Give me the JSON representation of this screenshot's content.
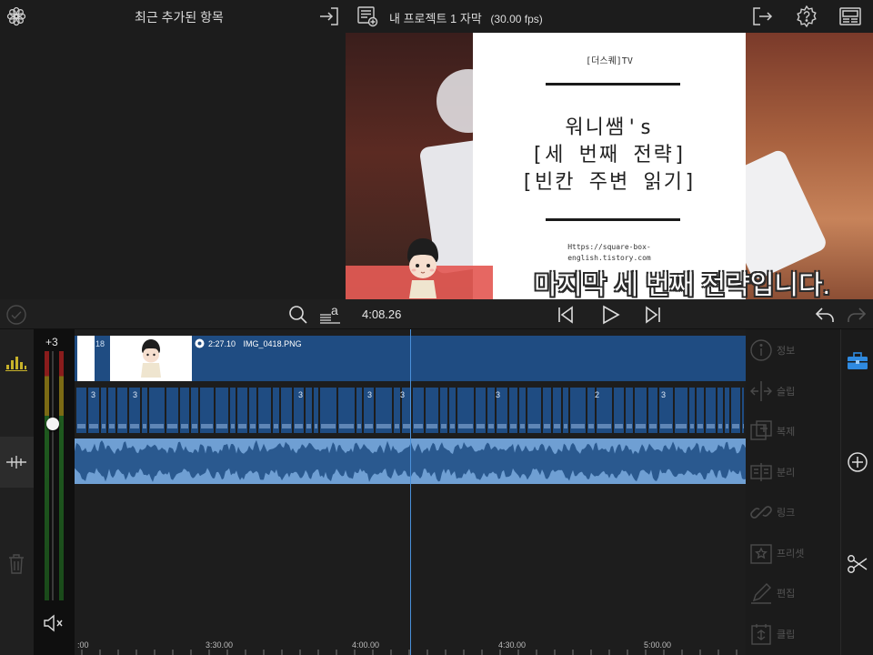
{
  "media_browser": {
    "title": "최근 추가된 항목"
  },
  "project": {
    "title": "내 프로젝트 1 자막",
    "fps": "(30.00 fps)"
  },
  "preview": {
    "card_brand": "[더스퀘]TV",
    "card_title_1": "워니쌤's",
    "card_title_2": "[세 번째 전략]",
    "card_title_3": "[빈칸 주변 읽기]",
    "card_url_1": "Https://square-box-",
    "card_url_2": "english.tistory.com",
    "subtitle": "마지막 세 번째 전략입니다."
  },
  "transport": {
    "timecode": "4:08.26"
  },
  "meter": {
    "level_label": "+3",
    "volume_level": 0.85
  },
  "timeline": {
    "clip_duration": "2:27.10",
    "clip_name": "IMG_0418.PNG",
    "clip_number_fragment": "18",
    "title_markers": [
      "3",
      "3",
      "3",
      "3",
      "3",
      "2",
      "3",
      "3"
    ],
    "ruler_labels": [
      ":00",
      "3:30.00",
      "4:00.00",
      "4:30.00",
      "5:00.00"
    ]
  },
  "tools": {
    "items": [
      {
        "label": "정보",
        "icon": "info-icon"
      },
      {
        "label": "슬립",
        "icon": "slip-icon"
      },
      {
        "label": "복제",
        "icon": "duplicate-icon"
      },
      {
        "label": "분리",
        "icon": "split-icon"
      },
      {
        "label": "링크",
        "icon": "link-icon"
      },
      {
        "label": "프리셋",
        "icon": "preset-icon"
      },
      {
        "label": "편집",
        "icon": "edit-icon"
      },
      {
        "label": "클립",
        "icon": "clip-icon"
      }
    ]
  },
  "colors": {
    "track_blue": "#1f4c82",
    "audio_blue": "#6f9fd3",
    "accent_blue": "#2f8ae0",
    "playhead": "#4a90d9"
  }
}
